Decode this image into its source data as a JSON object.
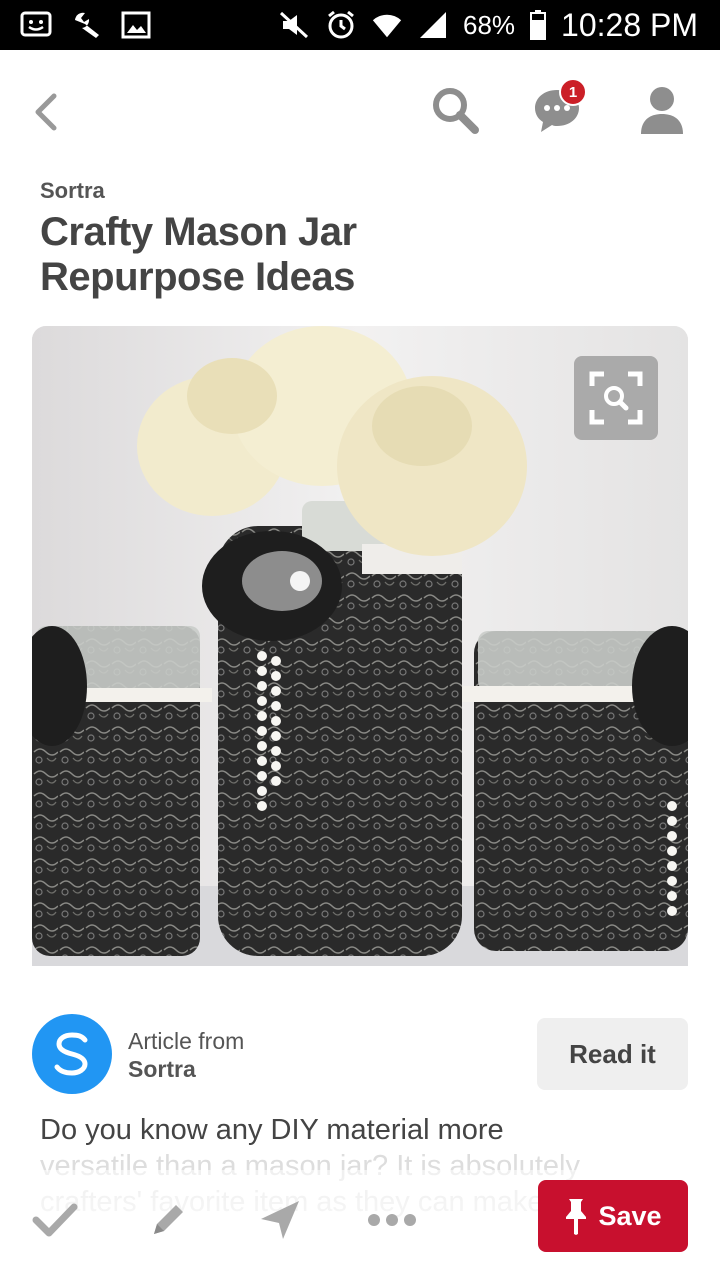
{
  "status_bar": {
    "battery": "68%",
    "time": "10:28 PM",
    "icons": [
      "screenshot-icon",
      "wrench-icon",
      "image-icon",
      "mute-icon",
      "alarm-icon",
      "wifi-icon",
      "signal-icon",
      "battery-icon"
    ]
  },
  "header": {
    "notification_count": "1",
    "icons": [
      "back-icon",
      "search-icon",
      "messages-icon",
      "profile-icon"
    ]
  },
  "pin": {
    "source": "Sortra",
    "title": "Crafty Mason Jar Repurpose Ideas"
  },
  "article": {
    "label": "Article from",
    "source": "Sortra",
    "read_button": "Read it"
  },
  "description": {
    "visible": "Do you know any DIY material more",
    "faded": "versatile than a mason jar? It is absolutely crafters' favorite item as they can make..."
  },
  "actions": {
    "save_label": "Save",
    "icons": [
      "check-icon",
      "edit-icon",
      "send-icon",
      "more-icon",
      "pin-icon"
    ]
  },
  "colors": {
    "brand_red": "#c8102e",
    "badge_red": "#cb1f27",
    "source_blue": "#2196f3"
  }
}
